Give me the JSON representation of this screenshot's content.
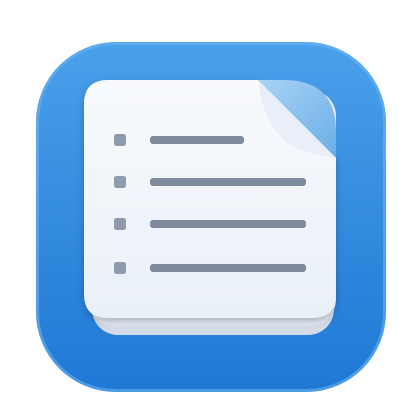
{
  "app_icon": {
    "name": "notes-list-app-icon",
    "depicts": "document-list-icon",
    "colors": {
      "background": "#ffffff",
      "tile_top": "#4aa0ea",
      "tile_bottom": "#1f78d4",
      "tile_rim": "#6fb6f2",
      "page": "#f4f7fc",
      "page_stack_1": "#e3e9f3",
      "page_stack_2": "#d3dbe8",
      "fold": "#8cc2f0",
      "fold_flap": "#e9eff8",
      "bullet": "#8f9bad",
      "line": "#7f8b9d"
    },
    "list": {
      "rows": 4,
      "line_lengths": [
        0.55,
        1.0,
        1.0,
        1.0
      ]
    }
  }
}
